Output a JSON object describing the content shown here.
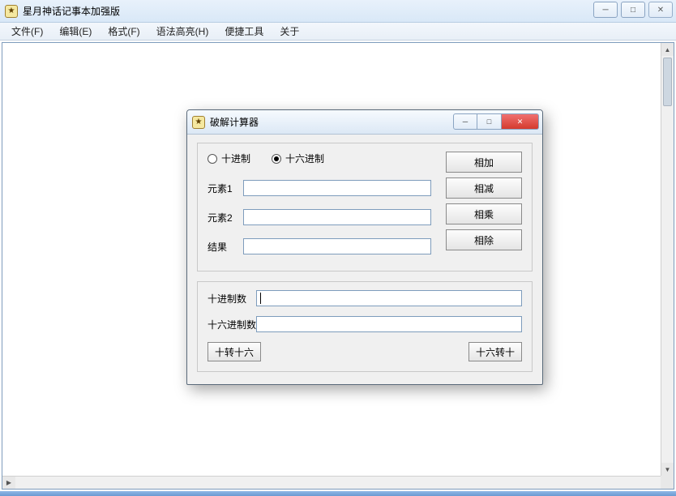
{
  "main_window": {
    "title": "星月神话记事本加强版",
    "win_buttons": {
      "min": "─",
      "max": "□",
      "close": "✕"
    }
  },
  "menubar": {
    "items": [
      "文件(F)",
      "编辑(E)",
      "格式(F)",
      "语法高亮(H)",
      "便捷工具",
      "关于"
    ]
  },
  "dialog": {
    "title": "破解计算器",
    "win_buttons": {
      "min": "─",
      "max": "□",
      "close": "✕"
    },
    "radios": {
      "dec": "十进制",
      "hex": "十六进制",
      "selected": "hex"
    },
    "labels": {
      "elem1": "元素1",
      "elem2": "元素2",
      "result": "结果"
    },
    "values": {
      "elem1": "",
      "elem2": "",
      "result": ""
    },
    "ops": {
      "add": "相加",
      "sub": "相减",
      "mul": "相乘",
      "div": "相除"
    },
    "conv": {
      "dec_label": "十进制数",
      "hex_label": "十六进制数",
      "dec_value": "",
      "hex_value": "",
      "dec_to_hex": "十转十六",
      "hex_to_dec": "十六转十"
    }
  }
}
